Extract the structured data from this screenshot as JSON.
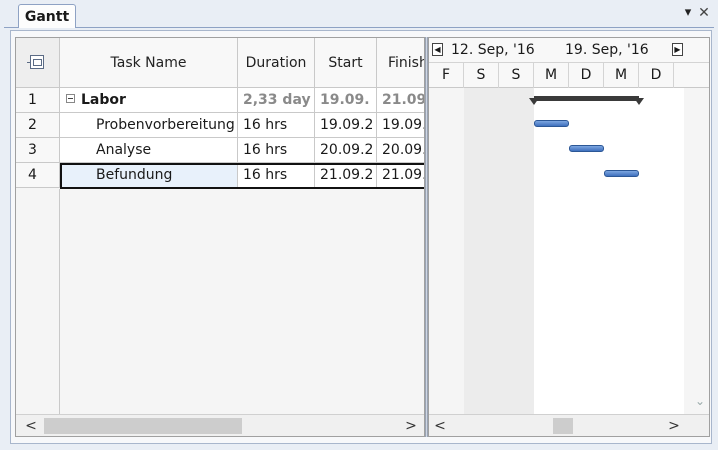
{
  "tab": {
    "label": "Gantt"
  },
  "window": {
    "dropdown_glyph": "▾",
    "close_glyph": "✕"
  },
  "grid": {
    "columns": {
      "task_name": "Task Name",
      "duration": "Duration",
      "start": "Start",
      "finish": "Finish"
    },
    "rows": [
      {
        "id": "1",
        "name": "Labor",
        "duration": "2,33 day",
        "start": "19.09.",
        "finish": "21.09",
        "summary": true
      },
      {
        "id": "2",
        "name": "Probenvorbereitung",
        "duration": "16 hrs",
        "start": "19.09.2",
        "finish": "19.09."
      },
      {
        "id": "3",
        "name": "Analyse",
        "duration": "16 hrs",
        "start": "20.09.2",
        "finish": "20.09."
      },
      {
        "id": "4",
        "name": "Befundung",
        "duration": "16 hrs",
        "start": "21.09.2",
        "finish": "21.09.",
        "selected": true
      }
    ]
  },
  "chart": {
    "weeks": [
      "12. Sep, '16",
      "19. Sep, '16"
    ],
    "days": [
      "F",
      "S",
      "S",
      "M",
      "D",
      "M",
      "D"
    ]
  },
  "scroll": {
    "left_arrow": "<",
    "right_arrow": ">",
    "down_arrow": "⌄"
  },
  "colors": {
    "bar_fill": "#3f70bd",
    "bar_border": "#2c5796",
    "summary_bar": "#3a3a3a",
    "selection": "#e8f1fb"
  }
}
